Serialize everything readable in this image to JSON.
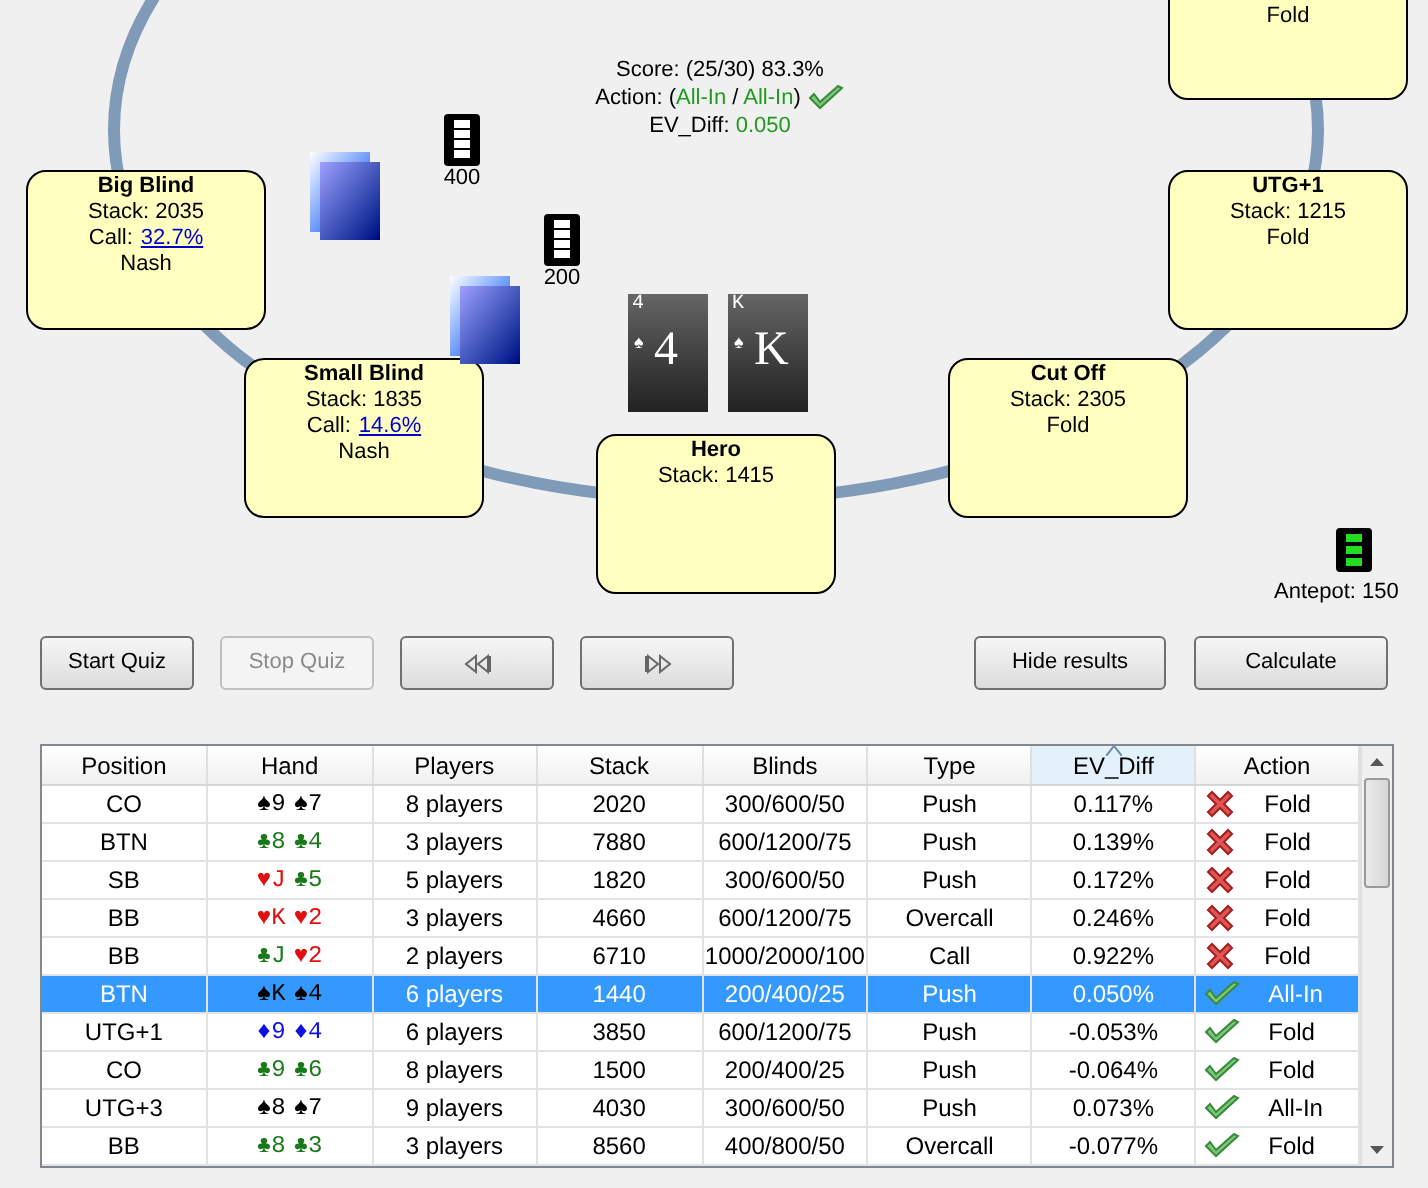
{
  "summary": {
    "lines": [
      [
        {
          "text": "Score: (25/30) 83.3%",
          "kind": "plain"
        }
      ],
      [
        {
          "text": "Action: (",
          "kind": "plain"
        },
        {
          "text": "All-In",
          "kind": "good"
        },
        {
          "text": " / ",
          "kind": "plain"
        },
        {
          "text": "All-In",
          "kind": "good"
        },
        {
          "text": ")",
          "kind": "plain"
        }
      ],
      [
        {
          "text": "EV_Diff: ",
          "kind": "plain"
        },
        {
          "text": "0.050",
          "kind": "good"
        }
      ]
    ],
    "correct": true
  },
  "seats": [
    {
      "kind": "top-right",
      "note": "Fold"
    },
    {
      "kind": "big-blind",
      "name": "Big Blind",
      "stack": "Stack: 2035",
      "call_label": "Call:",
      "call_value": "32.7%",
      "note": "Nash"
    },
    {
      "kind": "utg1",
      "name": "UTG+1",
      "stack": "Stack: 1215",
      "note": "Fold"
    },
    {
      "kind": "small-blind",
      "name": "Small Blind",
      "stack": "Stack: 1835",
      "call_label": "Call:",
      "call_value": "14.6%",
      "note": "Nash"
    },
    {
      "kind": "cut-off",
      "name": "Cut Off",
      "stack": "Stack: 2305",
      "note": "Fold"
    },
    {
      "kind": "hero",
      "name": "Hero",
      "stack": "Stack: 1415"
    }
  ],
  "bets": [
    {
      "kind": "big-blind",
      "amount": "400"
    },
    {
      "kind": "small-blind",
      "amount": "200"
    }
  ],
  "hero_cards": [
    {
      "corner": "4",
      "suit": "♠",
      "rank": "4"
    },
    {
      "corner": "K",
      "suit": "♠",
      "rank": "K"
    }
  ],
  "antepot": "Antepot: 150",
  "buttons": [
    {
      "label": "Start Quiz",
      "disabled": false,
      "kind": "text"
    },
    {
      "label": "Stop Quiz",
      "disabled": true,
      "kind": "text"
    },
    {
      "disabled": false,
      "kind": "rewind"
    },
    {
      "disabled": false,
      "kind": "forward"
    },
    {
      "label": "Hide results",
      "disabled": false,
      "kind": "text"
    },
    {
      "label": "Calculate",
      "disabled": false,
      "kind": "text"
    }
  ],
  "table": {
    "columns": [
      {
        "label": "Position",
        "sorted": false
      },
      {
        "label": "Hand",
        "sorted": false
      },
      {
        "label": "Players",
        "sorted": false
      },
      {
        "label": "Stack",
        "sorted": false
      },
      {
        "label": "Blinds",
        "sorted": false
      },
      {
        "label": "Type",
        "sorted": false
      },
      {
        "label": "EV_Diff",
        "sorted": true
      },
      {
        "label": "Action",
        "sorted": false
      }
    ],
    "rows": [
      {
        "position": "CO",
        "hand": [
          {
            "text": "♠9",
            "kind": "spade"
          },
          {
            "text": "♠7",
            "kind": "spade"
          }
        ],
        "players": "8 players",
        "stack": "2020",
        "blinds": "300/600/50",
        "type": "Push",
        "ev_diff": "0.117%",
        "correct": false,
        "action": "Fold",
        "selected": false
      },
      {
        "position": "BTN",
        "hand": [
          {
            "text": "♣8",
            "kind": "club"
          },
          {
            "text": "♣4",
            "kind": "club"
          }
        ],
        "players": "3 players",
        "stack": "7880",
        "blinds": "600/1200/75",
        "type": "Push",
        "ev_diff": "0.139%",
        "correct": false,
        "action": "Fold",
        "selected": false
      },
      {
        "position": "SB",
        "hand": [
          {
            "text": "♥J",
            "kind": "heart"
          },
          {
            "text": "♣5",
            "kind": "club"
          }
        ],
        "players": "5 players",
        "stack": "1820",
        "blinds": "300/600/50",
        "type": "Push",
        "ev_diff": "0.172%",
        "correct": false,
        "action": "Fold",
        "selected": false
      },
      {
        "position": "BB",
        "hand": [
          {
            "text": "♥K",
            "kind": "heart"
          },
          {
            "text": "♥2",
            "kind": "heart"
          }
        ],
        "players": "3 players",
        "stack": "4660",
        "blinds": "600/1200/75",
        "type": "Overcall",
        "ev_diff": "0.246%",
        "correct": false,
        "action": "Fold",
        "selected": false
      },
      {
        "position": "BB",
        "hand": [
          {
            "text": "♣J",
            "kind": "club"
          },
          {
            "text": "♥2",
            "kind": "heart"
          }
        ],
        "players": "2 players",
        "stack": "6710",
        "blinds": "1000/2000/100",
        "type": "Call",
        "ev_diff": "0.922%",
        "correct": false,
        "action": "Fold",
        "selected": false
      },
      {
        "position": "BTN",
        "hand": [
          {
            "text": "♠K",
            "kind": "spade"
          },
          {
            "text": "♠4",
            "kind": "spade"
          }
        ],
        "players": "6 players",
        "stack": "1440",
        "blinds": "200/400/25",
        "type": "Push",
        "ev_diff": "0.050%",
        "correct": true,
        "action": "All-In",
        "selected": true
      },
      {
        "position": "UTG+1",
        "hand": [
          {
            "text": "♦9",
            "kind": "diamond"
          },
          {
            "text": "♦4",
            "kind": "diamond"
          }
        ],
        "players": "6 players",
        "stack": "3850",
        "blinds": "600/1200/75",
        "type": "Push",
        "ev_diff": "-0.053%",
        "correct": true,
        "action": "Fold",
        "selected": false
      },
      {
        "position": "CO",
        "hand": [
          {
            "text": "♣9",
            "kind": "club"
          },
          {
            "text": "♣6",
            "kind": "club"
          }
        ],
        "players": "8 players",
        "stack": "1500",
        "blinds": "200/400/25",
        "type": "Push",
        "ev_diff": "-0.064%",
        "correct": true,
        "action": "Fold",
        "selected": false
      },
      {
        "position": "UTG+3",
        "hand": [
          {
            "text": "♠8",
            "kind": "spade"
          },
          {
            "text": "♠7",
            "kind": "spade"
          }
        ],
        "players": "9 players",
        "stack": "4030",
        "blinds": "300/600/50",
        "type": "Push",
        "ev_diff": "0.073%",
        "correct": true,
        "action": "All-In",
        "selected": false
      },
      {
        "position": "BB",
        "hand": [
          {
            "text": "♣8",
            "kind": "club"
          },
          {
            "text": "♣3",
            "kind": "club"
          }
        ],
        "players": "3 players",
        "stack": "8560",
        "blinds": "400/800/50",
        "type": "Overcall",
        "ev_diff": "-0.077%",
        "correct": true,
        "action": "Fold",
        "selected": false
      }
    ]
  }
}
